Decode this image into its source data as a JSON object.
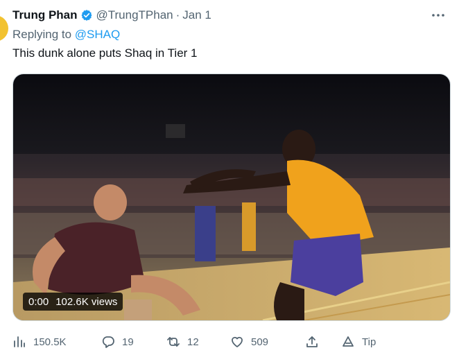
{
  "tweet": {
    "author_name": "Trung Phan",
    "author_handle": "@TrungTPhan",
    "separator": "·",
    "date": "Jan 1",
    "replying_prefix": "Replying to",
    "replying_to": "@SHAQ",
    "text": "This dunk alone puts Shaq in Tier 1"
  },
  "video": {
    "time": "0:00",
    "views": "102.6K views"
  },
  "actions": {
    "views_count": "150.5K",
    "reply_count": "19",
    "retweet_count": "12",
    "like_count": "509",
    "tip_label": "Tip"
  },
  "icons": {
    "verified": "verified-badge-icon",
    "more": "more-dots-icon",
    "views": "analytics-bars-icon",
    "reply": "reply-bubble-icon",
    "retweet": "retweet-arrows-icon",
    "like": "heart-icon",
    "share": "share-upload-icon",
    "tip": "tip-icon"
  },
  "colors": {
    "link_blue": "#1d9bf0",
    "muted_text": "#536471",
    "text": "#0f1419"
  }
}
